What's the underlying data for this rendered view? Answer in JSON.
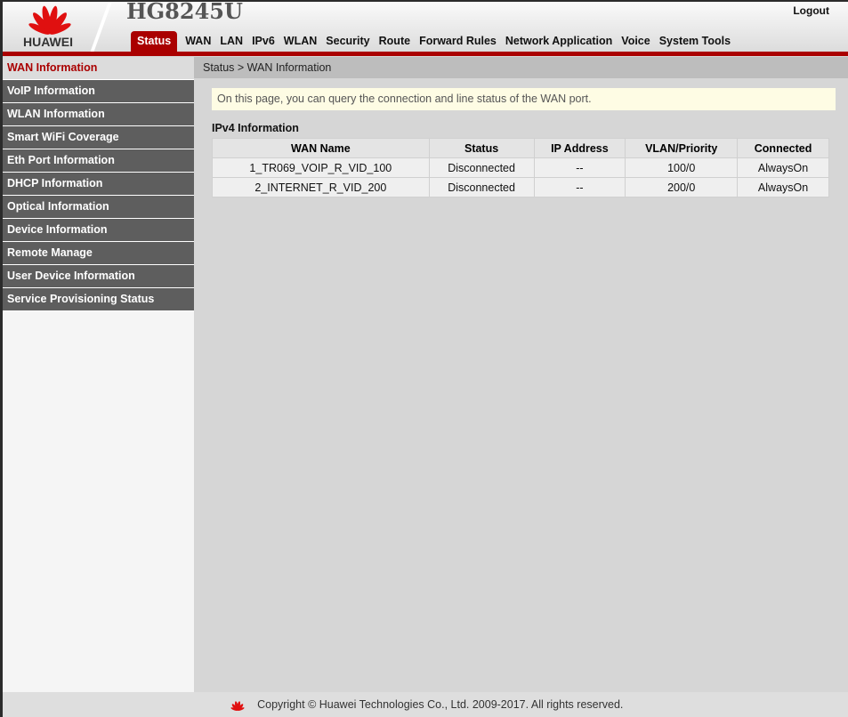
{
  "header": {
    "brand": "HUAWEI",
    "model": "HG8245U",
    "logout": "Logout"
  },
  "nav": [
    "Status",
    "WAN",
    "LAN",
    "IPv6",
    "WLAN",
    "Security",
    "Route",
    "Forward Rules",
    "Network Application",
    "Voice",
    "System Tools"
  ],
  "sidebar": [
    "WAN Information",
    "VoIP Information",
    "WLAN Information",
    "Smart WiFi Coverage",
    "Eth Port Information",
    "DHCP Information",
    "Optical Information",
    "Device Information",
    "Remote Manage",
    "User Device Information",
    "Service Provisioning Status"
  ],
  "breadcrumb": "Status > WAN Information",
  "note": "On this page, you can query the connection and line status of the WAN port.",
  "ipv4": {
    "title": "IPv4 Information",
    "columns": [
      "WAN Name",
      "Status",
      "IP Address",
      "VLAN/Priority",
      "Connected"
    ],
    "rows": [
      [
        "1_TR069_VOIP_R_VID_100",
        "Disconnected",
        "--",
        "100/0",
        "AlwaysOn"
      ],
      [
        "2_INTERNET_R_VID_200",
        "Disconnected",
        "--",
        "200/0",
        "AlwaysOn"
      ]
    ]
  },
  "footer": "Copyright © Huawei Technologies Co., Ltd. 2009-2017. All rights reserved.",
  "colors": {
    "accent": "#aa0000"
  }
}
